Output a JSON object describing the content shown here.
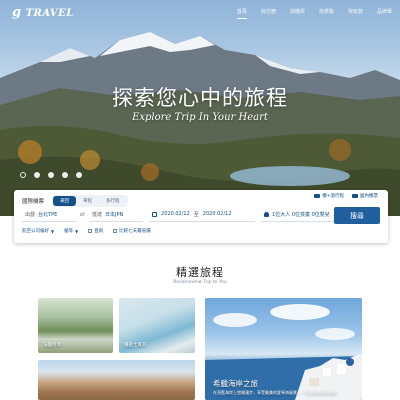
{
  "brand": {
    "logo_g": "g",
    "logo_text": "TRAVEL"
  },
  "nav": {
    "items": [
      "首頁",
      "找住宿",
      "找機票",
      "找景點",
      "常玩旅",
      "品牌專"
    ],
    "active_index": 0
  },
  "hero": {
    "title": "探索您心中的旅程",
    "subtitle": "Explore Trip In Your Heart",
    "slide_count": 5,
    "active_slide": 0
  },
  "search": {
    "section_label": "國際機票",
    "trip_tabs": [
      "來回",
      "單程",
      "多行程"
    ],
    "active_trip_tab": 0,
    "links": [
      "機+酒行程",
      "國內機票"
    ],
    "from_label": "出發",
    "from_value": "台北TPE",
    "swap_icon": "swap-arrows-icon",
    "to_label": "抵達",
    "to_value": "日本JPN",
    "depart_date": "2020.02/12",
    "date_separator": "至",
    "return_date": "2020.02/12",
    "passengers": "1位大人 0位孩童 0位嬰兒",
    "search_button": "搜尋",
    "options": {
      "airline": "航空公司偏好",
      "cabin": "艙等",
      "direct": "直飛",
      "flexible": "比較七天最低價"
    }
  },
  "recommended": {
    "title": "精選旅程",
    "subtitle": "Recommend Trip to You",
    "cards": [
      {
        "caption": "法國河岸"
      },
      {
        "caption": "優遊土耳其"
      },
      {
        "caption": ""
      }
    ],
    "featured": {
      "title": "希臘海岸之旅",
      "desc": "在湛藍海岸上悠閒漫步，享受最美的愛琴海風景，一生必去的夢幻景點"
    }
  },
  "colors": {
    "primary": "#14508a",
    "button": "#1f5f9e"
  }
}
